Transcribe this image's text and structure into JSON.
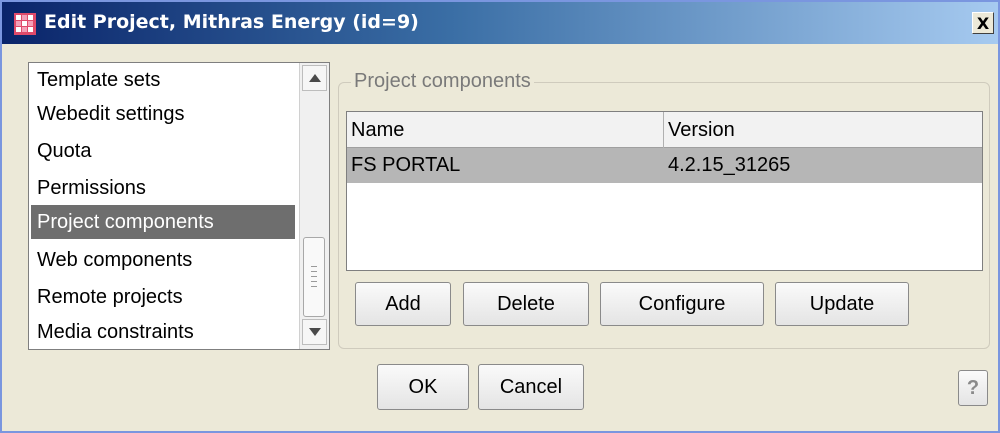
{
  "window": {
    "title": "Edit Project, Mithras Energy (id=9)",
    "close_label": "X"
  },
  "nav": {
    "items": [
      {
        "label": "Template sets",
        "selected": false
      },
      {
        "label": "Webedit settings",
        "selected": false
      },
      {
        "label": "Quota",
        "selected": false
      },
      {
        "label": "Permissions",
        "selected": false
      },
      {
        "label": "Project components",
        "selected": true
      },
      {
        "label": "Web components",
        "selected": false
      },
      {
        "label": "Remote projects",
        "selected": false
      },
      {
        "label": "Media constraints",
        "selected": false
      }
    ]
  },
  "panel": {
    "group_title": "Project components",
    "table": {
      "columns": [
        "Name",
        "Version"
      ],
      "rows": [
        {
          "name": "FS PORTAL",
          "version": "4.2.15_31265",
          "selected": true
        }
      ]
    },
    "buttons": {
      "add": "Add",
      "delete": "Delete",
      "configure": "Configure",
      "update": "Update"
    }
  },
  "dialog": {
    "ok": "OK",
    "cancel": "Cancel",
    "help": "?"
  },
  "colors": {
    "title_bar_start": "#0a246a",
    "title_bar_end": "#a6caf0",
    "window_bg": "#ece9d8",
    "selection_nav": "#6e6e6e",
    "selection_row": "#b6b6b6"
  }
}
